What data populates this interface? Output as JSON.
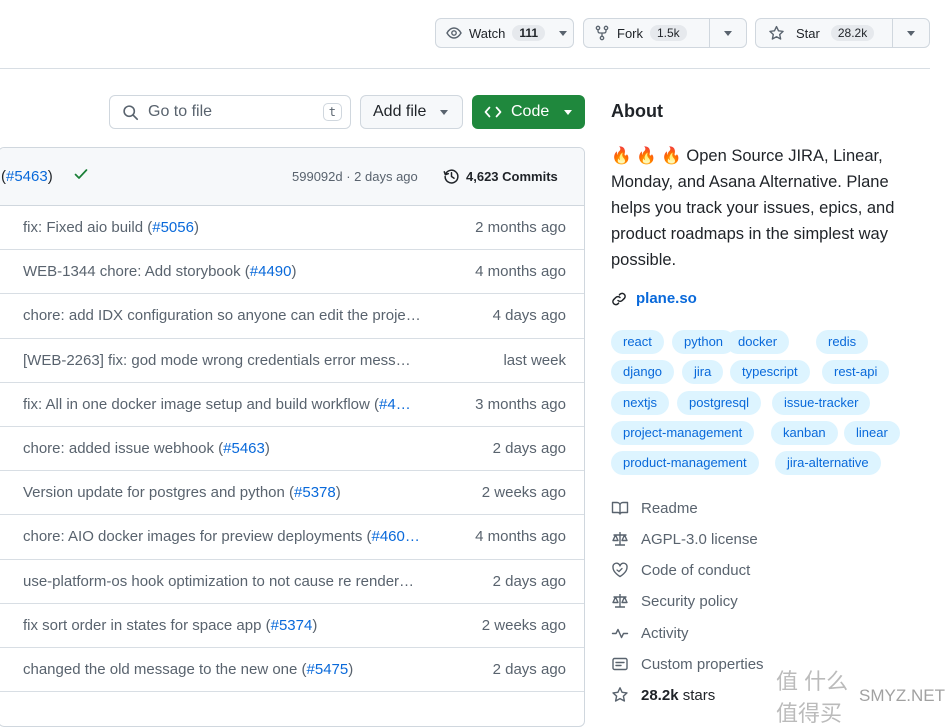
{
  "repo_actions": {
    "watch": {
      "label": "Watch",
      "count": "111"
    },
    "fork": {
      "label": "Fork",
      "count": "1.5k"
    },
    "star": {
      "label": "Star",
      "count": "28.2k"
    }
  },
  "file_toolbar": {
    "go_to_file": "Go to file",
    "shortcut": "t",
    "add_file": "Add file",
    "code": "Code"
  },
  "latest_commit": {
    "pr_ref": "#5463",
    "hash_time": "599092d · 2 days ago",
    "commits_count": "4,623 Commits"
  },
  "rows": [
    {
      "msg": "fix: Fixed aio build (",
      "pr": "#5056",
      "tail": ")",
      "time": "2 months ago"
    },
    {
      "msg": "WEB-1344 chore: Add storybook (",
      "pr": "#4490",
      "tail": ")",
      "time": "4 months ago"
    },
    {
      "msg": "chore: add IDX configuration so anyone can edit the proje…",
      "pr": "",
      "tail": "",
      "time": "4 days ago"
    },
    {
      "msg": "[WEB-2263] fix: god mode wrong credentials error mess…",
      "pr": "",
      "tail": "",
      "time": "last week"
    },
    {
      "msg": "fix: All in one docker image setup and build workflow (",
      "pr": "#4…",
      "tail": "",
      "time": "3 months ago"
    },
    {
      "msg": "chore: added issue webhook (",
      "pr": "#5463",
      "tail": ")",
      "time": "2 days ago"
    },
    {
      "msg": "Version update for postgres and python (",
      "pr": "#5378",
      "tail": ")",
      "time": "2 weeks ago"
    },
    {
      "msg": "chore: AIO docker images for preview deployments (",
      "pr": "#460…",
      "tail": "",
      "time": "4 months ago"
    },
    {
      "msg": "use-platform-os hook optimization to not cause re render…",
      "pr": "",
      "tail": "",
      "time": "2 days ago"
    },
    {
      "msg": "fix sort order in states for space app (",
      "pr": "#5374",
      "tail": ")",
      "time": "2 weeks ago"
    },
    {
      "msg": "changed the old message to the new one (",
      "pr": "#5475",
      "tail": ")",
      "time": "2 days ago"
    }
  ],
  "about": {
    "title": "About",
    "description": "🔥 🔥 🔥 Open Source JIRA, Linear, Monday, and Asana Alternative. Plane helps you track your issues, epics, and product roadmaps in the simplest way possible.",
    "website": "plane.so",
    "topics": [
      "react",
      "python",
      "docker",
      "redis",
      "django",
      "jira",
      "typescript",
      "rest-api",
      "nextjs",
      "postgresql",
      "issue-tracker",
      "project-management",
      "kanban",
      "linear",
      "product-management",
      "jira-alternative"
    ],
    "readme": "Readme",
    "license": "AGPL-3.0 license",
    "conduct": "Code of conduct",
    "security": "Security policy",
    "activity": "Activity",
    "custom_properties": "Custom properties",
    "stars": "28.2k",
    "stars_suffix": " stars"
  },
  "watermark": {
    "logo_text": "值 什么值得买",
    "site": "SMYZ.NET"
  },
  "colors": {
    "accent": "#0969da",
    "code_button": "#1f883d",
    "success": "#1a7f37",
    "topic_bg": "#ddf4ff"
  }
}
